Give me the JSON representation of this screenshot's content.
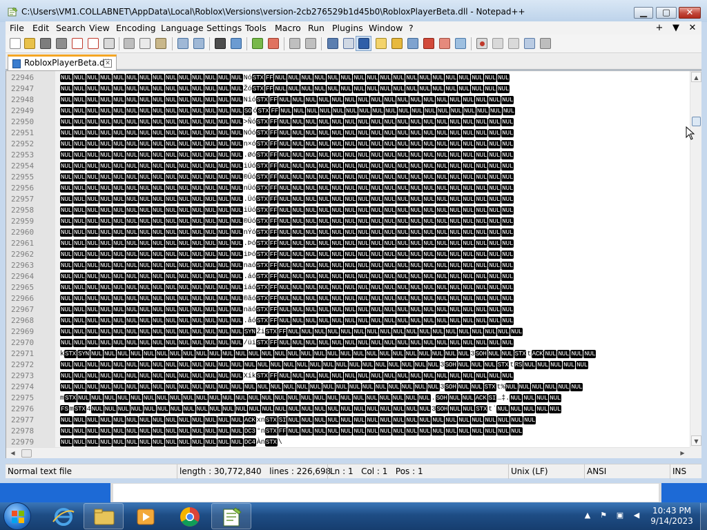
{
  "window": {
    "title": "C:\\Users\\VM1.COLLABNET\\AppData\\Local\\Roblox\\Versions\\version-2cb276529b1d45b0\\RobloxPlayerBeta.dll - Notepad++",
    "min_glyph": "▁",
    "max_glyph": "▢",
    "close_glyph": "✕"
  },
  "menu": {
    "items": [
      "File",
      "Edit",
      "Search",
      "View",
      "Encoding",
      "Language",
      "Settings",
      "Tools",
      "Macro",
      "Run",
      "Plugins",
      "Window",
      "?"
    ],
    "right_buttons": [
      "+",
      "▼",
      "✕"
    ]
  },
  "toolbar": {
    "buttons": [
      "new-file",
      "open-file",
      "save",
      "save-all",
      "close",
      "close-all",
      "print",
      "cut",
      "copy",
      "paste",
      "undo",
      "redo",
      "find",
      "replace",
      "zoom-in",
      "zoom-out",
      "sync-vertical",
      "sync-horizontal",
      "word-wrap",
      "show-all-characters",
      "indent-guide",
      "user-language",
      "document-map",
      "function-list",
      "folder-workspace",
      "monitoring",
      "macro-record",
      "macro-stop",
      "macro-play",
      "macro-run-multiple",
      "macro-save"
    ]
  },
  "tab": {
    "label": "RobloxPlayerBeta.dll",
    "close_glyph": "✕"
  },
  "editor": {
    "lines": [
      {
        "n": "22946",
        "t": "NUL NUL NUL NUL NUL NUL NUL NUL NUL NUL NUL NUL NUL NUL Nó STX FF NUL NUL NUL NUL NUL NUL NUL NUL NUL NUL NUL NUL NUL NUL NUL NUL NUL NUL"
      },
      {
        "n": "22947",
        "t": "NUL NUL NUL NUL NUL NUL NUL NUL NUL NUL NUL NUL NUL NUL Žó STX FF NUL NUL NUL NUL NUL NUL NUL NUL NUL NUL NUL NUL NUL NUL NUL NUL NUL NUL"
      },
      {
        "n": "22948",
        "t": "NUL NUL NUL NUL NUL NUL NUL NUL NUL NUL NUL NUL NUL NUL Nió STX FF NUL NUL NUL NUL NUL NUL NUL NUL NUL NUL NUL NUL NUL NUL NUL NUL NUL NUL"
      },
      {
        "n": "22949",
        "t": "NUL NUL NUL NUL NUL NUL NUL NUL NUL NUL NUL NUL NUL NUL SO ó STX FF NUL NUL NUL NUL NUL NUL NUL NUL NUL NUL NUL NUL NUL NUL NUL NUL NUL NUL"
      },
      {
        "n": "22950",
        "t": "NUL NUL NUL NUL NUL NUL NUL NUL NUL NUL NUL NUL NUL NUL >Ñó STX FF NUL NUL NUL NUL NUL NUL NUL NUL NUL NUL NUL NUL NUL NUL NUL NUL NUL NUL"
      },
      {
        "n": "22951",
        "t": "NUL NUL NUL NUL NUL NUL NUL NUL NUL NUL NUL NUL NUL NUL NÓó STX FF NUL NUL NUL NUL NUL NUL NUL NUL NUL NUL NUL NUL NUL NUL NUL NUL NUL NUL"
      },
      {
        "n": "22952",
        "t": "NUL NUL NUL NUL NUL NUL NUL NUL NUL NUL NUL NUL NUL NUL n×ó STX FF NUL NUL NUL NUL NUL NUL NUL NUL NUL NUL NUL NUL NUL NUL NUL NUL NUL NUL"
      },
      {
        "n": "22953",
        "t": "NUL NUL NUL NUL NUL NUL NUL NUL NUL NUL NUL NUL NUL NUL .Øó STX FF NUL NUL NUL NUL NUL NUL NUL NUL NUL NUL NUL NUL NUL NUL NUL NUL NUL NUL"
      },
      {
        "n": "22954",
        "t": "NUL NUL NUL NUL NUL NUL NUL NUL NUL NUL NUL NUL NUL NUL iÚó STX FF NUL NUL NUL NUL NUL NUL NUL NUL NUL NUL NUL NUL NUL NUL NUL NUL NUL NUL"
      },
      {
        "n": "22955",
        "t": "NUL NUL NUL NUL NUL NUL NUL NUL NUL NUL NUL NUL NUL NUL ®Ûó STX FF NUL NUL NUL NUL NUL NUL NUL NUL NUL NUL NUL NUL NUL NUL NUL NUL NUL NUL"
      },
      {
        "n": "22956",
        "t": "NUL NUL NUL NUL NUL NUL NUL NUL NUL NUL NUL NUL NUL NUL nÜó STX FF NUL NUL NUL NUL NUL NUL NUL NUL NUL NUL NUL NUL NUL NUL NUL NUL NUL NUL"
      },
      {
        "n": "22957",
        "t": "NUL NUL NUL NUL NUL NUL NUL NUL NUL NUL NUL NUL NUL NUL .Üó STX FF NUL NUL NUL NUL NUL NUL NUL NUL NUL NUL NUL NUL NUL NUL NUL NUL NUL NUL"
      },
      {
        "n": "22958",
        "t": "NUL NUL NUL NUL NUL NUL NUL NUL NUL NUL NUL NUL NUL NUL iÜó STX FF NUL NUL NUL NUL NUL NUL NUL NUL NUL NUL NUL NUL NUL NUL NUL NUL NUL NUL"
      },
      {
        "n": "22959",
        "t": "NUL NUL NUL NUL NUL NUL NUL NUL NUL NUL NUL NUL NUL NUL ®Üó STX FF NUL NUL NUL NUL NUL NUL NUL NUL NUL NUL NUL NUL NUL NUL NUL NUL NUL NUL"
      },
      {
        "n": "22960",
        "t": "NUL NUL NUL NUL NUL NUL NUL NUL NUL NUL NUL NUL NUL NUL nÝó STX FF NUL NUL NUL NUL NUL NUL NUL NUL NUL NUL NUL NUL NUL NUL NUL NUL NUL NUL"
      },
      {
        "n": "22961",
        "t": "NUL NUL NUL NUL NUL NUL NUL NUL NUL NUL NUL NUL NUL NUL .Þó STX FF NUL NUL NUL NUL NUL NUL NUL NUL NUL NUL NUL NUL NUL NUL NUL NUL NUL NUL"
      },
      {
        "n": "22962",
        "t": "NUL NUL NUL NUL NUL NUL NUL NUL NUL NUL NUL NUL NUL NUL iÞó STX FF NUL NUL NUL NUL NUL NUL NUL NUL NUL NUL NUL NUL NUL NUL NUL NUL NUL NUL"
      },
      {
        "n": "22963",
        "t": "NUL NUL NUL NUL NUL NUL NUL NUL NUL NUL NUL NUL NUL NUL naó STX FF NUL NUL NUL NUL NUL NUL NUL NUL NUL NUL NUL NUL NUL NUL NUL NUL NUL NUL"
      },
      {
        "n": "22964",
        "t": "NUL NUL NUL NUL NUL NUL NUL NUL NUL NUL NUL NUL NUL NUL .áó STX FF NUL NUL NUL NUL NUL NUL NUL NUL NUL NUL NUL NUL NUL NUL NUL NUL NUL NUL"
      },
      {
        "n": "22965",
        "t": "NUL NUL NUL NUL NUL NUL NUL NUL NUL NUL NUL NUL NUL NUL iáó STX FF NUL NUL NUL NUL NUL NUL NUL NUL NUL NUL NUL NUL NUL NUL NUL NUL NUL NUL"
      },
      {
        "n": "22966",
        "t": "NUL NUL NUL NUL NUL NUL NUL NUL NUL NUL NUL NUL NUL NUL ®ãó STX FF NUL NUL NUL NUL NUL NUL NUL NUL NUL NUL NUL NUL NUL NUL NUL NUL NUL NUL"
      },
      {
        "n": "22967",
        "t": "NUL NUL NUL NUL NUL NUL NUL NUL NUL NUL NUL NUL NUL NUL näó STX FF NUL NUL NUL NUL NUL NUL NUL NUL NUL NUL NUL NUL NUL NUL NUL NUL NUL NUL"
      },
      {
        "n": "22968",
        "t": "NUL NUL NUL NUL NUL NUL NUL NUL NUL NUL NUL NUL NUL NUL .åó STX FF NUL NUL NUL NUL NUL NUL NUL NUL NUL NUL NUL NUL NUL NUL NUL NUL NUL NUL"
      },
      {
        "n": "22969",
        "t": "NUL NUL NUL NUL NUL NUL NUL NUL NUL NUL NUL NUL NUL NUL SYN Ži STX FF NUL NUL NUL NUL NUL NUL NUL NUL NUL NUL NUL NUL NUL NUL NUL NUL NUL NUL"
      },
      {
        "n": "22970",
        "t": "NUL NUL NUL NUL NUL NUL NUL NUL NUL NUL NUL NUL NUL NUL /üi STX FF NUL NUL NUL NUL NUL NUL NUL NUL NUL NUL NUL NUL NUL NUL NUL NUL NUL NUL"
      },
      {
        "n": "22971",
        "t": "k STX SYN NUL NUL NUL NUL NUL NUL NUL NUL NUL NUL NUL NUL NUL NUL NUL NUL NUL NUL NUL NUL NUL NUL NUL NUL NUL NUL NUL NUL NUL 3 SOH NUL NUL STX t ACK NUL NUL NUL NUL"
      },
      {
        "n": "22972",
        "t": "NUL NUL NUL NUL NUL NUL NUL NUL NUL NUL NUL NUL NUL NUL NUL NUL NUL NUL NUL NUL NUL NUL NUL NUL NUL NUL NUL NUL NUL 3 SOH NUL NUL NUL STX t RS NUL NUL NUL NUL NUL"
      },
      {
        "n": "22973",
        "t": "NUL NUL NUL NUL NUL NUL NUL NUL NUL NUL NUL NUL NUL NUL Xík STX FF NUL NUL NUL NUL NUL NUL NUL NUL NUL NUL NUL NUL NUL NUL NUL NUL NUL NUL"
      },
      {
        "n": "22974",
        "t": "NUL NUL NUL NUL NUL NUL NUL NUL NUL NUL NUL NUL NUL NUL NUL NUL NUL NUL NUL NUL NUL NUL NUL NUL NUL NUL NUL NUL NUL 3 SOH NUL NUL STX t% NUL NUL NUL NUL NUL NUL"
      },
      {
        "n": "22975",
        "t": "m STX  NUL NUL NUL NUL NUL NUL NUL NUL NUL NUL NUL NUL NUL NUL NUL NUL NUL NUL NUL NUL NUL NUL NUL NUL NUL NUL NUL . SOH NUL NUL ACK SI …‡. NUL NUL NUL NUL"
      },
      {
        "n": "22976",
        "t": "FS m STX 4 NUL NUL NUL NUL NUL NUL NUL NUL NUL NUL NUL NUL NUL NUL NUL NUL NUL NUL NUL NUL NUL NUL NUL NUL NUL NUL 3 SOH NUL NUL STX t` NUL NUL NUL NUL NUL"
      },
      {
        "n": "22977",
        "t": "NUL NUL NUL NUL NUL NUL NUL NUL NUL NUL NUL NUL NUL NUL ACK xn STX SI NUL NUL NUL NUL NUL NUL NUL NUL NUL NUL NUL NUL NUL NUL NUL NUL NUL NUL NUL"
      },
      {
        "n": "22978",
        "t": "NUL NUL NUL NUL NUL NUL NUL NUL NUL NUL NUL NUL NUL NUL DC3 °n STX FF NUL NUL NUL NUL NUL NUL NUL NUL NUL NUL NUL NUL NUL NUL NUL NUL NUL NUL"
      },
      {
        "n": "22979",
        "t": "NUL NUL NUL NUL NUL NUL NUL NUL NUL NUL NUL NUL NUL NUL DC4 Àn STX \\"
      }
    ]
  },
  "status": {
    "type": "Normal text file",
    "length": "length : 30,772,840",
    "lines": "lines : 226,698",
    "ln": "Ln : 1",
    "col": "Col : 1",
    "pos": "Pos : 1",
    "eol": "Unix (LF)",
    "encoding": "ANSI",
    "mode": "INS"
  },
  "taskbar": {
    "apps": [
      "internet-explorer",
      "file-explorer",
      "media-player",
      "chrome",
      "notepad-plus-plus"
    ],
    "clock_time": "10:43 PM",
    "clock_date": "9/14/2023"
  },
  "colors": {
    "control_char_bg": "#000000",
    "tab_accent": "#f5a623",
    "titlebar": "#c6d8ed",
    "taskbar": "#1e4d85"
  }
}
